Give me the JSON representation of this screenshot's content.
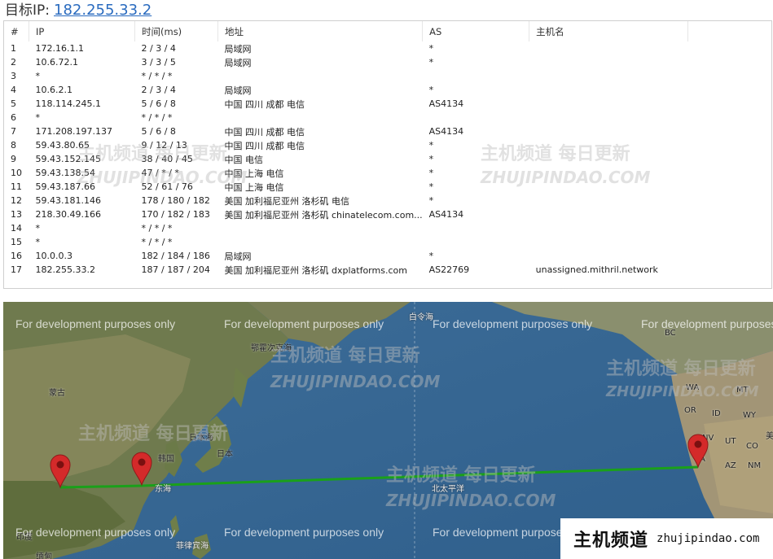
{
  "header": {
    "label": "目标IP:",
    "ip": "182.255.33.2"
  },
  "table": {
    "columns": [
      "#",
      "IP",
      "时间(ms)",
      "地址",
      "AS",
      "主机名"
    ],
    "rows": [
      {
        "n": "1",
        "ip": "172.16.1.1",
        "time": "2 / 3 / 4",
        "addr": "局域网",
        "as": "*",
        "host": ""
      },
      {
        "n": "2",
        "ip": "10.6.72.1",
        "time": "3 / 3 / 5",
        "addr": "局域网",
        "as": "*",
        "host": ""
      },
      {
        "n": "3",
        "ip": "*",
        "time": "* / * / *",
        "addr": "",
        "as": "",
        "host": ""
      },
      {
        "n": "4",
        "ip": "10.6.2.1",
        "time": "2 / 3 / 4",
        "addr": "局域网",
        "as": "*",
        "host": ""
      },
      {
        "n": "5",
        "ip": "118.114.245.1",
        "time": "5 / 6 / 8",
        "addr": "中国 四川 成都 电信",
        "as": "AS4134",
        "host": ""
      },
      {
        "n": "6",
        "ip": "*",
        "time": "* / * / *",
        "addr": "",
        "as": "",
        "host": ""
      },
      {
        "n": "7",
        "ip": "171.208.197.137",
        "time": "5 / 6 / 8",
        "addr": "中国 四川 成都 电信",
        "as": "AS4134",
        "host": ""
      },
      {
        "n": "8",
        "ip": "59.43.80.65",
        "time": "9 / 12 / 13",
        "addr": "中国 四川 成都 电信",
        "as": "*",
        "host": ""
      },
      {
        "n": "9",
        "ip": "59.43.152.145",
        "time": "38 / 40 / 45",
        "addr": "中国 电信",
        "as": "*",
        "host": ""
      },
      {
        "n": "10",
        "ip": "59.43.138.54",
        "time": "47 / * / *",
        "addr": "中国 上海 电信",
        "as": "*",
        "host": ""
      },
      {
        "n": "11",
        "ip": "59.43.187.66",
        "time": "52 / 61 / 76",
        "addr": "中国 上海 电信",
        "as": "*",
        "host": ""
      },
      {
        "n": "12",
        "ip": "59.43.181.146",
        "time": "178 / 180 / 182",
        "addr": "美国 加利福尼亚州 洛杉矶 电信",
        "as": "*",
        "host": ""
      },
      {
        "n": "13",
        "ip": "218.30.49.166",
        "time": "170 / 182 / 183",
        "addr": "美国 加利福尼亚州 洛杉矶 chinatelecom.com...",
        "as": "AS4134",
        "host": ""
      },
      {
        "n": "14",
        "ip": "*",
        "time": "* / * / *",
        "addr": "",
        "as": "",
        "host": ""
      },
      {
        "n": "15",
        "ip": "*",
        "time": "* / * / *",
        "addr": "",
        "as": "",
        "host": ""
      },
      {
        "n": "16",
        "ip": "10.0.0.3",
        "time": "182 / 184 / 186",
        "addr": "局域网",
        "as": "*",
        "host": ""
      },
      {
        "n": "17",
        "ip": "182.255.33.2",
        "time": "187 / 187 / 204",
        "addr": "美国 加利福尼亚州 洛杉矶 dxplatforms.com",
        "as": "AS22769",
        "host": "unassigned.mithril.network"
      }
    ]
  },
  "watermark": {
    "cn": "主机频道 每日更新",
    "en": "ZHUJIPINDAO.COM"
  },
  "map": {
    "dev_notice": "For development purposes only",
    "labels": {
      "sea_of_okhotsk": "鄂霍次克海",
      "bering_sea": "白令海",
      "mongolia": "蒙古",
      "sea_of_japan": "日本海",
      "korea": "韩国",
      "japan": "日本",
      "east_china_sea": "东海",
      "north_pacific": "北太平洋",
      "philippine_sea": "菲律宾海",
      "india": "印度",
      "myanmar": "缅甸",
      "bc": "BC",
      "wa": "WA",
      "or": "OR",
      "id": "ID",
      "mt": "MT",
      "wy": "WY",
      "nv": "NV",
      "ut": "UT",
      "ca": "CA",
      "az": "AZ",
      "nm": "NM",
      "co": "CO",
      "usa": "美"
    },
    "route_color": "#1aa01a",
    "pin_color": "#d42a2a"
  },
  "brand": {
    "cn": "主机频道",
    "en": "zhujipindao.com"
  }
}
